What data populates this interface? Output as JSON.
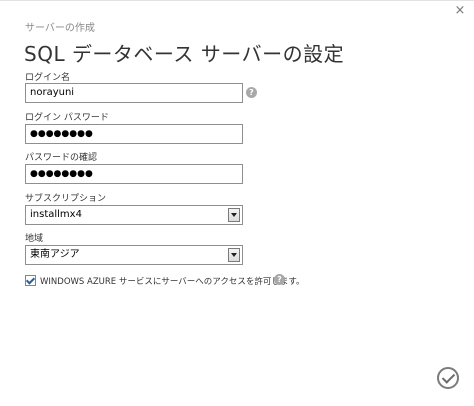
{
  "dialog": {
    "close_label": "×",
    "subtitle": "サーバーの作成",
    "title": "SQL データベース サーバーの設定"
  },
  "form": {
    "login_label": "ログイン名",
    "login_value": "norayuni",
    "password_label": "ログイン パスワード",
    "password_value": "●●●●●●●●",
    "confirm_label": "パスワードの確認",
    "confirm_value": "●●●●●●●●",
    "subscription_label": "サブスクリプション",
    "subscription_value": "installmx4",
    "region_label": "地域",
    "region_value": "東南アジア",
    "azure_access_label": "WINDOWS AZURE サービスにサーバーへのアクセスを許可します。",
    "azure_access_checked": true,
    "help_glyph": "?"
  },
  "icons": {
    "help": "help-icon",
    "close": "close-icon",
    "ok": "checkmark-icon"
  }
}
